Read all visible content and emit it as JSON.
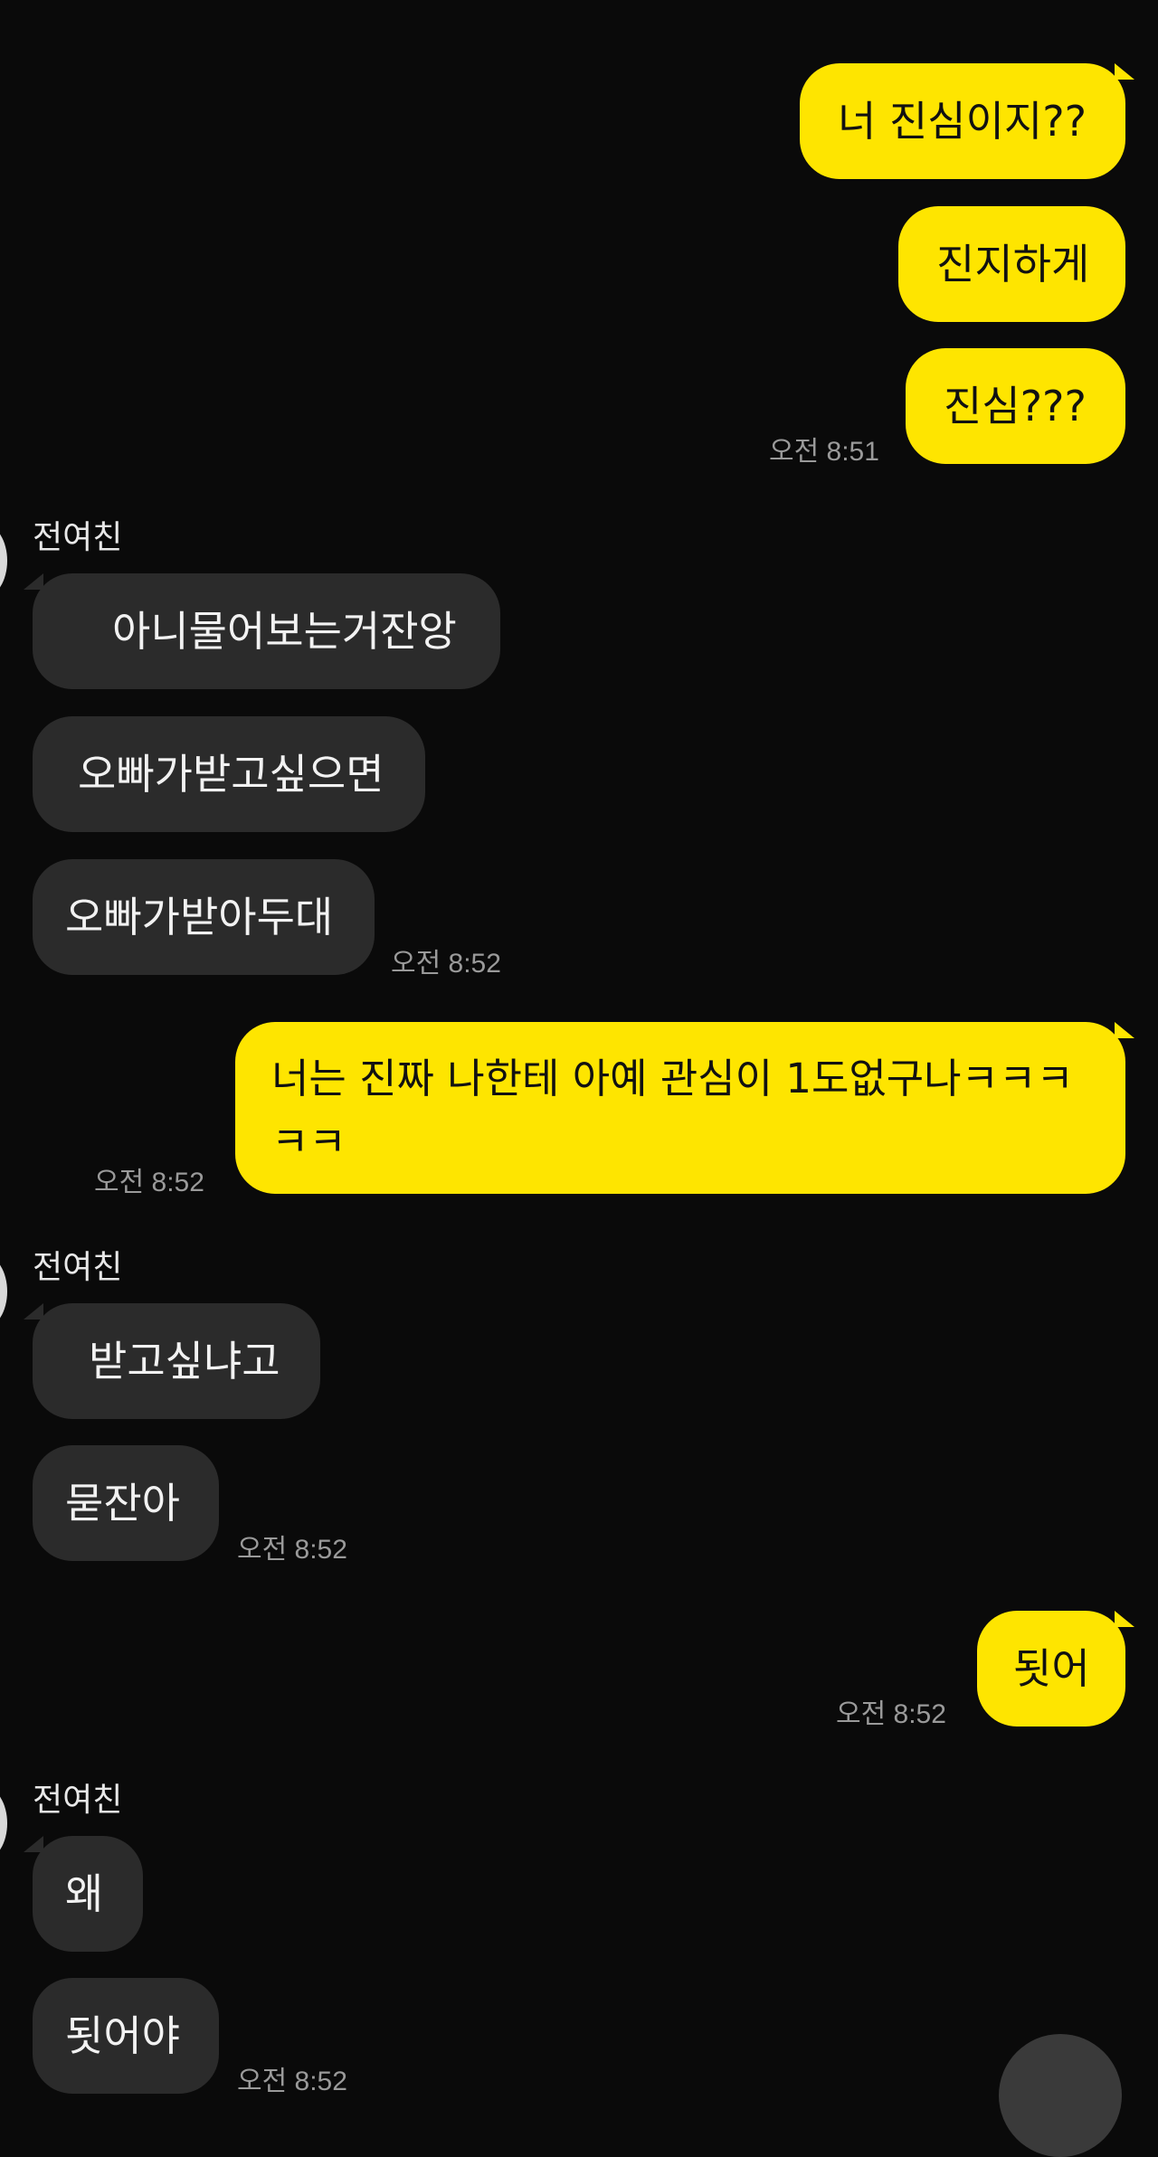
{
  "conversation": {
    "messages": [
      {
        "id": "m1",
        "side": "me",
        "text": "너 진심이지??"
      },
      {
        "id": "m2",
        "side": "me",
        "text": "진지하게"
      },
      {
        "id": "m3",
        "side": "me",
        "text": "진심???",
        "time": "오전 8:51"
      },
      {
        "id": "s1",
        "sender": "전여친"
      },
      {
        "id": "m4",
        "side": "them",
        "text": "아니물어보는거잔앙"
      },
      {
        "id": "m5",
        "side": "them",
        "text": "오빠가받고싶으면"
      },
      {
        "id": "m6",
        "side": "them",
        "text": "오빠가받아두대",
        "time": "오전 8:52"
      },
      {
        "id": "m7",
        "side": "me",
        "text": "너는 진짜 나한테 아예 관심이 1도없구나ㅋㅋㅋ ㅋㅋ",
        "time": "오전 8:52"
      },
      {
        "id": "s2",
        "sender": "전여친"
      },
      {
        "id": "m8",
        "side": "them",
        "text": "받고싶냐고"
      },
      {
        "id": "m9",
        "side": "them",
        "text": "묻잔아",
        "time": "오전 8:52"
      },
      {
        "id": "m10",
        "side": "me",
        "text": "됫어",
        "time": "오전 8:52"
      },
      {
        "id": "s3",
        "sender": "전여친"
      },
      {
        "id": "m11",
        "side": "them",
        "text": "왜"
      },
      {
        "id": "m12",
        "side": "them",
        "text": "됫어야",
        "time": "오전 8:52"
      }
    ]
  },
  "colors": {
    "background": "#0a0a0a",
    "my_bubble": "#fee500",
    "their_bubble": "#2b2b2b"
  }
}
